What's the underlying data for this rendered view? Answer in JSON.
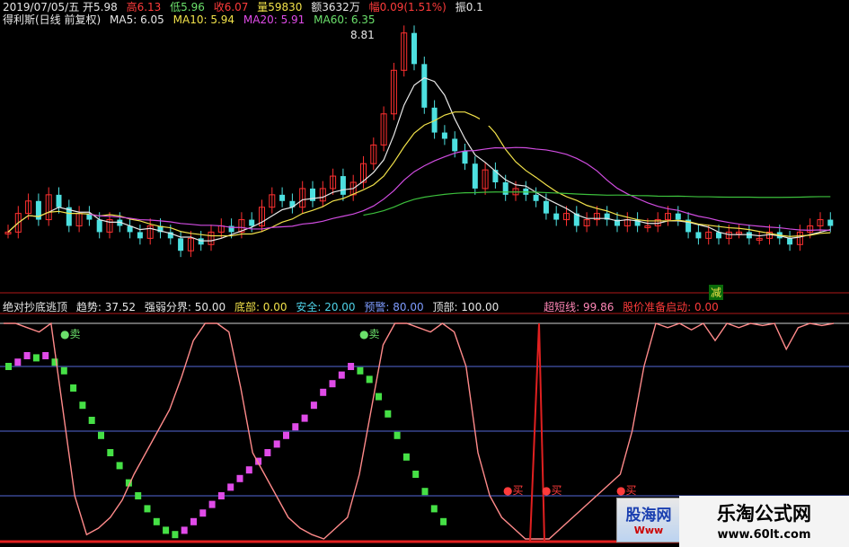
{
  "header": {
    "name": "得利斯(日线 前复权)",
    "ma5_label": "MA5: 6.05",
    "ma10_label": "MA10: 5.94",
    "ma20_label": "MA20: 5.91",
    "ma60_label": "MA60: 6.35",
    "date_open": "2019/07/05/五  开5.98",
    "high": "高6.13",
    "low": "低5.96",
    "close": "收6.07",
    "volume": "量59830",
    "amount": "额3632万",
    "change": "幅0.09(1.51%)",
    "amplitude": "振0.1"
  },
  "price_panel": {
    "peak_label": "8.81",
    "sell_mark": "减"
  },
  "indicator": {
    "title": "绝对抄底逃顶",
    "trend": "趋势: 37.52",
    "strong_weak": "强弱分界: 50.00",
    "bottom": "底部: 0.00",
    "safe": "安全: 20.00",
    "warning": "预警: 80.00",
    "top": "顶部: 100.00",
    "super_short": "超短线: 99.86",
    "start": "股价准备启动: 0.00",
    "sell1": "卖",
    "sell2": "卖",
    "buy1": "买",
    "buy2": "买",
    "buy3": "买"
  },
  "watermarks": {
    "wm1_line1": "股海网",
    "wm1_line2": "Www",
    "wm2_line1": "乐淘公式网",
    "wm2_line2": "www.60lt.com"
  },
  "colors": {
    "up": "#ff3030",
    "down": "#4de0e0",
    "ma5": "#e8e8e8",
    "ma10": "#f2e24a",
    "ma20": "#d04ce0",
    "ma60": "#3cbf3c",
    "trend_up": "#e04be8",
    "trend_down": "#46e046",
    "osc": "#ff8a8a"
  }
}
